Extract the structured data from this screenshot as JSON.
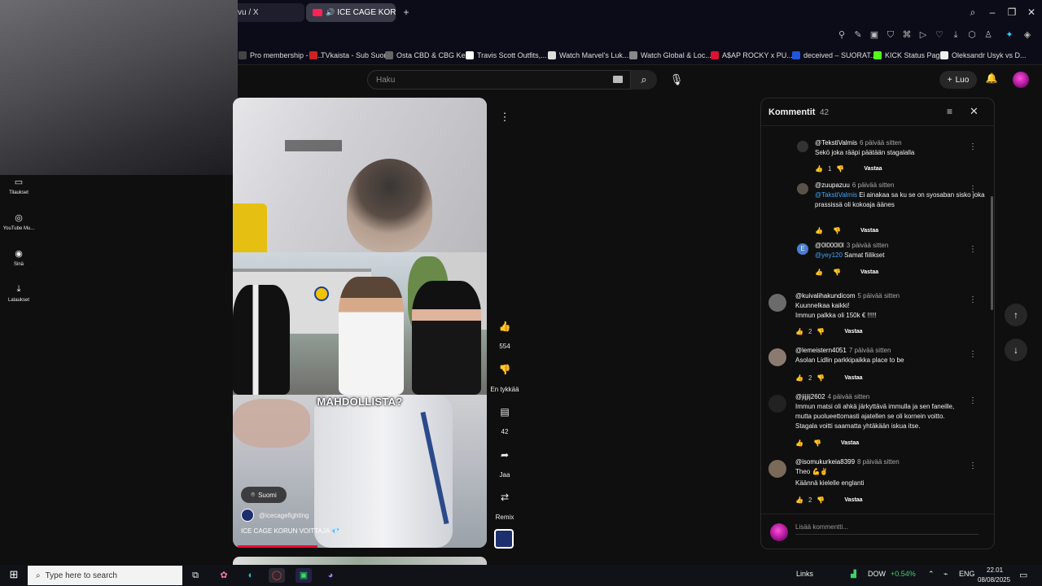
{
  "browser": {
    "tabs": [
      {
        "label": "vu / X"
      },
      {
        "label": "ICE CAGE KORUN VOI"
      }
    ],
    "new_tab": "+",
    "bookmarks": [
      {
        "label": "Pro membership - G...",
        "color": "#444444"
      },
      {
        "label": "TVkaista - Sub Suora",
        "color": "#cc2222"
      },
      {
        "label": "Osta CBD & CBG Ke...",
        "color": "#666666"
      },
      {
        "label": "Travis Scott Outfits,...",
        "color": "#ffffff"
      },
      {
        "label": "Watch Marvel's Luk...",
        "color": "#dddddd"
      },
      {
        "label": "Watch Global & Loc...",
        "color": "#888888"
      },
      {
        "label": "A$AP ROCKY x PU...",
        "color": "#dd1133"
      },
      {
        "label": "deceived – SUORAT...",
        "color": "#2255dd"
      },
      {
        "label": "KICK Status Page",
        "color": "#53fc18"
      },
      {
        "label": "Oleksandr Usyk vs D...",
        "color": "#eeeeee"
      }
    ]
  },
  "youtube": {
    "search_placeholder": "Haku",
    "create_label": "Luo",
    "sidebar": [
      {
        "label": "Tilaukset",
        "icon": "subscriptions-icon"
      },
      {
        "label": "YouTube Mu...",
        "icon": "youtube-music-icon"
      },
      {
        "label": "Sinä",
        "icon": "you-icon"
      },
      {
        "label": "Lataukset",
        "icon": "downloads-icon"
      }
    ]
  },
  "short": {
    "overlay_text": "MAHDOLLISTA?",
    "location": "Suomi",
    "channel": "@icecagefighting",
    "title": "ICE CAGE KORUN VOITTAJA 💎",
    "progress_fraction": 0.32,
    "actions": {
      "like_count": "554",
      "dislike_label": "En tykkää",
      "comments_count": "42",
      "share_label": "Jaa",
      "remix_label": "Remix"
    }
  },
  "comments": {
    "title": "Kommentit",
    "count": "42",
    "add_placeholder": "Lisää kommentti...",
    "items": [
      {
        "author": "@TekstiValmis",
        "time": "6 päivää sitten",
        "text": "Sekö joka rääpi päätään stagalalla",
        "mention": "",
        "likes": "1",
        "reply": "Vastaa",
        "avatar_color": "#333333"
      },
      {
        "author": "@zuupazuu",
        "time": "6 päivää sitten",
        "mention": "@TakstiValmis",
        "text": "Ei ainakaa sa ku se on syosaban sisko joka prassissä oli kokoaja äänes",
        "likes": "",
        "reply": "Vastaa",
        "avatar_color": "#5a5248"
      },
      {
        "author": "@0l000l0l",
        "time": "3 päivää sitten",
        "mention": "@yey120",
        "text": "Samat fiilikset",
        "likes": "",
        "reply": "Vastaa",
        "avatar_color": "#4a7fd0",
        "avatar_letter": "E"
      },
      {
        "author": "@kuivalihakundicom",
        "time": "5 päivää sitten",
        "mention": "",
        "text": "Kuunnelkaa kaikki!\nImmun palkka oli 150k € !!!!!",
        "likes": "2",
        "reply": "Vastaa",
        "avatar_color": "#6b6b6b"
      },
      {
        "author": "@lemeistern4051",
        "time": "7 päivää sitten",
        "mention": "",
        "text": "Asolan Lidlin parkkipaikka place to be",
        "likes": "2",
        "reply": "Vastaa",
        "avatar_color": "#8a7a70"
      },
      {
        "author": "@jijjij2602",
        "time": "4 päivää sitten",
        "mention": "",
        "text": "Immun matsi oli ahkä järkyttävä immulla ja sen faneille, mutta puolueettomasti ajatellen se oli kornein voitto. Stagala voitti saamatta yhtäkään iskua itse.",
        "likes": "",
        "reply": "Vastaa",
        "avatar_color": "#222222"
      },
      {
        "author": "@isomukurkeia8399",
        "time": "8 päivää sitten",
        "mention": "",
        "text": "Theo 💪✌",
        "translate": "Käännä kielelle englanti",
        "likes": "2",
        "reply": "Vastaa",
        "avatar_color": "#7a6a5a"
      }
    ]
  },
  "taskbar": {
    "search_placeholder": "Type here to search",
    "links": "Links",
    "ticker": "DOW",
    "ticker_change": "+0.54%",
    "lang": "ENG",
    "time": "22.01",
    "date": "08/08/2025",
    "ticker_color": "#3fd16a"
  }
}
